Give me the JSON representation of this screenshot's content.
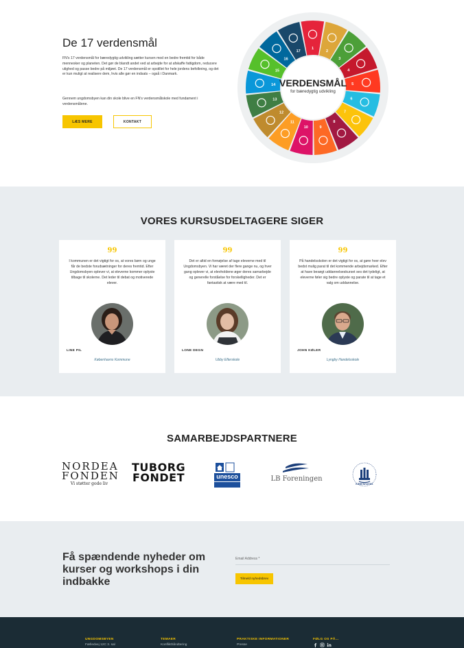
{
  "hero": {
    "title": "De 17 verdensmål",
    "paragraph1": "FN's 17 verdensmål for bæredygtig udvikling sætter kursen mod en bedre fremtid for både mennesker og planeten. Det gør de blandt andet ved at arbejde for at afskaffe fattigdom, reducere ulighed og passe bedre på miljøet. De 17 verdensmål er opstillet for hele jordens befolkning, og det er kun muligt at realisere dem, hvis alle gør en indsats – også i Danmark.",
    "paragraph2": "Gennem ungdomsbyen kan din skole blive en FN's verdensmålskole med fundament i verdensmålene.",
    "primary_button": "LÆS MERE",
    "secondary_button": "KONTAKT",
    "wheel": {
      "title": "VERDENSMÅL",
      "subtitle": "for bæredygtig udvikling",
      "numbers": [
        "1",
        "2",
        "3",
        "4",
        "5",
        "6",
        "7",
        "8",
        "9",
        "10",
        "11",
        "12",
        "13",
        "14",
        "15",
        "16",
        "17"
      ],
      "colors": [
        "#e5243b",
        "#dda63a",
        "#4c9f38",
        "#c5192d",
        "#ff3a21",
        "#26bde2",
        "#fcc30b",
        "#a21942",
        "#fd6925",
        "#dd1367",
        "#fd9d24",
        "#bf8b2e",
        "#3f7e44",
        "#0a97d9",
        "#56c02b",
        "#00689d",
        "#19486a"
      ]
    }
  },
  "testimonials": {
    "title": "VORES KURSUSDELTAGERE SIGER",
    "quote_mark": "99",
    "cards": [
      {
        "text": "I kommunen er det vigtigt for os, at vores børn og unge får de bedste forudsætninger for deres fremtid. Efter Ungdomsbyen oplever vi, at eleverne kommer oplyste tilbage til skolerne. Det leder til debat og motiverede elever.",
        "name": "LINE PIL",
        "org": "Københavns Kommune"
      },
      {
        "text": "Det er altid en fornøjelse af tage eleverne med til Ungdomsbyen. Vi har været der flere gange nu, og hver gang oplever vi, at elevholdene øger deres samarbejde og generelle forståelse for forskelligheder. Det er fantastisk at være med til.",
        "name": "LONE DEGN",
        "org": "Ubby Efterskole"
      },
      {
        "text": "På handelsskolen er det vigtigt for os, at gøre hver elev bedst mulig parat til det kommende arbejdsmarked. Efter at have besøgt uddannelseskurset ses det tydeligt, at eleverne føler sig bedre oplyste og parate til at tage et valg om uddannelse.",
        "name": "JOHN KØLER",
        "org": "Lyngby Handelsskole"
      }
    ]
  },
  "partners": {
    "title": "SAMARBEJDSPARTNERE",
    "nordea_line1": "NORDEA",
    "nordea_line2": "FONDEN",
    "nordea_tagline": "Vi støtter gode liv",
    "tuborg_line1": "TUBORG",
    "tuborg_line2": "FONDET",
    "unesco": "unesco",
    "lb": "LB Foreningen",
    "kbh": "KØBENHAVNS"
  },
  "newsletter": {
    "heading": "Få spændende nyheder om kurser og workshops i din indbakke",
    "email_label": "Email Address *",
    "button": "Tilmeld nyhedsbrev"
  },
  "footer": {
    "col1_head": "UNGDOMSBYEN",
    "col1_item": "Fælledvej 12C 3. sal",
    "col2_head": "TEMAER",
    "col2_item": "Konflikthåndtering",
    "col3_head": "PRAKTISKE INFORMATIONER",
    "col3_item": "Presse",
    "col4_head": "FØLG OS PÅ...",
    "icons": [
      "facebook-icon",
      "instagram-icon",
      "linkedin-icon"
    ],
    "accent": "#f7c500"
  }
}
